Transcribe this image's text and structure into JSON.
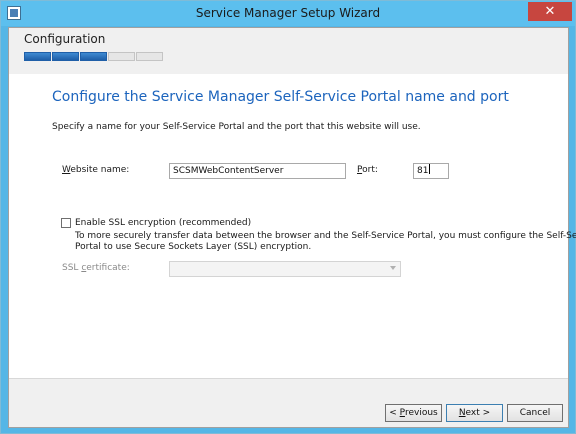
{
  "window": {
    "title": "Service Manager Setup Wizard",
    "close_glyph": "✕"
  },
  "header": {
    "page_heading": "Configuration",
    "progress": {
      "completed_steps": 3,
      "total_steps": 5
    }
  },
  "main": {
    "heading": "Configure the Service Manager Self-Service Portal name and port",
    "description": "Specify a name for your Self-Service Portal and the port that this website will use.",
    "website_name": {
      "label_u": "W",
      "label_rest": "ebsite name:",
      "value": "SCSMWebContentServer"
    },
    "port": {
      "label_u": "P",
      "label_rest": "ort:",
      "value": "81"
    },
    "ssl": {
      "checked": false,
      "label": "Enable SSL encryption (recommended)",
      "note_line1": "To more securely transfer data between the browser and the Self-Service Portal, you must configure the Self-Service",
      "note_line2": "Portal to use Secure Sockets Layer (SSL) encryption."
    },
    "ssl_certificate": {
      "label_pre": "SSL ",
      "label_u": "c",
      "label_rest": "ertificate:",
      "value": ""
    }
  },
  "footer": {
    "previous": {
      "prefix": "< ",
      "u": "P",
      "rest": "revious"
    },
    "next": {
      "u": "N",
      "rest": "ext >"
    },
    "cancel_label": "Cancel"
  },
  "colors": {
    "accent": "#1c64bd",
    "titlebar": "#5cbfee",
    "close": "#c7463f",
    "progress": "#1f5fa8"
  }
}
